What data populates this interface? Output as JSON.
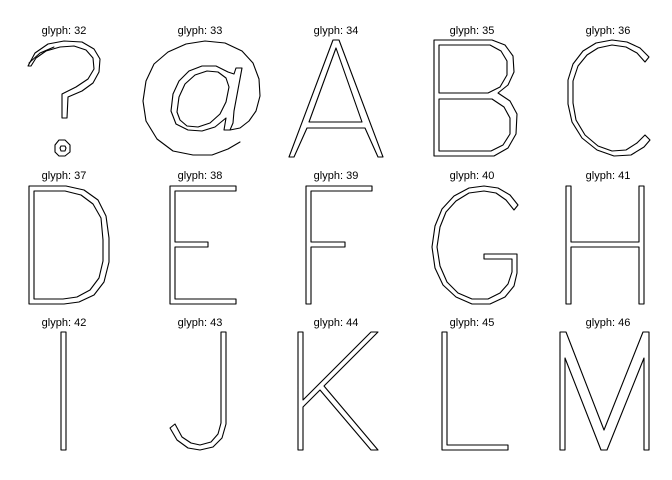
{
  "glyphs": [
    {
      "label": "glyph: 32",
      "icon": "question-mark-glyph"
    },
    {
      "label": "glyph: 33",
      "icon": "at-sign-glyph"
    },
    {
      "label": "glyph: 34",
      "icon": "letter-a-glyph"
    },
    {
      "label": "glyph: 35",
      "icon": "letter-b-glyph"
    },
    {
      "label": "glyph: 36",
      "icon": "letter-c-glyph"
    },
    {
      "label": "glyph: 37",
      "icon": "letter-d-glyph"
    },
    {
      "label": "glyph: 38",
      "icon": "letter-e-glyph"
    },
    {
      "label": "glyph: 39",
      "icon": "letter-f-glyph"
    },
    {
      "label": "glyph: 40",
      "icon": "letter-g-glyph"
    },
    {
      "label": "glyph: 41",
      "icon": "letter-h-glyph"
    },
    {
      "label": "glyph: 42",
      "icon": "letter-i-glyph"
    },
    {
      "label": "glyph: 43",
      "icon": "letter-j-glyph"
    },
    {
      "label": "glyph: 44",
      "icon": "letter-k-glyph"
    },
    {
      "label": "glyph: 45",
      "icon": "letter-l-glyph"
    },
    {
      "label": "glyph: 46",
      "icon": "letter-m-glyph"
    }
  ],
  "colors": {
    "background": "#ffffff",
    "stroke": "#000000"
  }
}
